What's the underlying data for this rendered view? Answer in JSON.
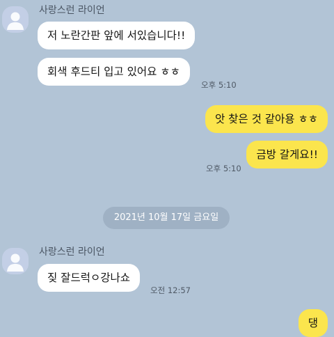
{
  "chat": {
    "date_divider": "2021년 10월 17일 금요일",
    "groups": [
      {
        "sender": "사랑스런 라이언",
        "messages": [
          "저 노란간판 앞에 서있습니다!!",
          "회색 후드티 입고 있어요 ㅎㅎ"
        ],
        "time": "오후 5:10"
      },
      {
        "messages": [
          "앗 찾은 것 같아용 ㅎㅎ",
          "금방 갈게요!!"
        ],
        "time": "오후 5:10"
      },
      {
        "sender": "사랑스런 라이언",
        "messages": [
          "짖 잘드럭ㅇ강나쇼"
        ],
        "time": "오전 12:57"
      },
      {
        "messages": [
          "댕"
        ]
      }
    ]
  },
  "colors": {
    "background": "#b2c4d6",
    "outgoing_bubble": "#fbe54d",
    "incoming_bubble": "#ffffff",
    "date_pill": "#9fb1c4"
  },
  "icons": {
    "avatar": "person-silhouette-icon"
  }
}
